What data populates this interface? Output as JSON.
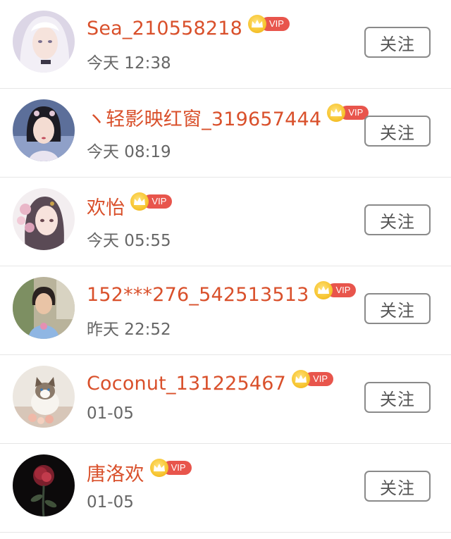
{
  "users": [
    {
      "name": "Sea_210558218",
      "time": "今天 12:38",
      "avatar_icon": "anime-girl-white-hair-avatar"
    },
    {
      "name": "ヽ轻影映红窗_319657444",
      "time": "今天 08:19",
      "avatar_icon": "costume-woman-avatar"
    },
    {
      "name": "欢怡",
      "time": "今天 05:55",
      "avatar_icon": "anime-girl-flowers-avatar"
    },
    {
      "name": "152***276_542513513",
      "time": "昨天 22:52",
      "avatar_icon": "child-photo-avatar"
    },
    {
      "name": "Coconut_131225467",
      "time": "01-05",
      "avatar_icon": "cat-photo-avatar"
    },
    {
      "name": "唐洛欢",
      "time": "01-05",
      "avatar_icon": "red-rose-avatar"
    }
  ],
  "vip_label": "VIP",
  "follow_label": "关注",
  "colors": {
    "name": "#d9502b",
    "vip_tag": "#e8554c",
    "crown": "#f7c531",
    "time": "#666666",
    "button_border": "#8a8a8a"
  }
}
